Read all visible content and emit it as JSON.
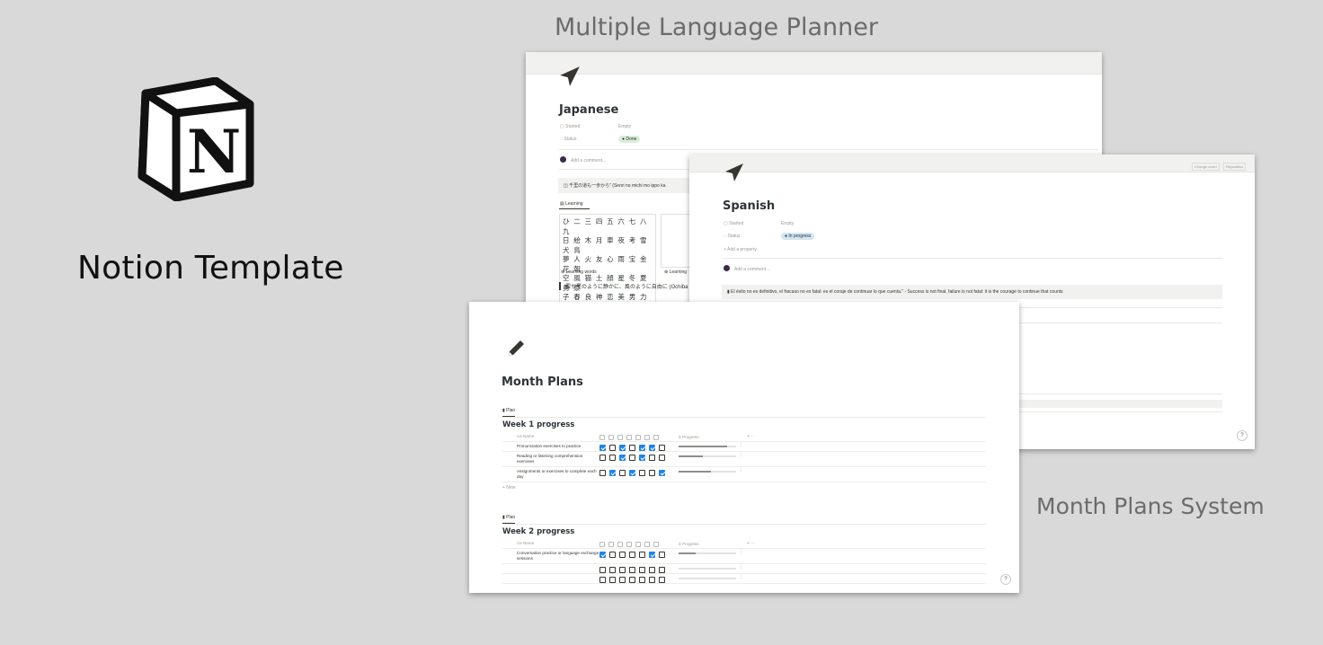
{
  "brand": {
    "title": "Notion Template",
    "logo_letter": "N"
  },
  "captions": {
    "top": "Multiple Language Planner",
    "right": "Month Plans System"
  },
  "japanese": {
    "title": "Japanese",
    "icon": "navigation-arrow-icon",
    "props": [
      {
        "label": "Started",
        "value": "Empty"
      },
      {
        "label": "Status",
        "value": "Done"
      }
    ],
    "comment_placeholder": "Add a comment...",
    "callout": "千里の道も一歩から\" (Senri no michi mo ippo ka",
    "db_tab": "Learning",
    "kanji_lines": [
      "ひ 二 三 四 五 六 七 八 九",
      "日 絵 木 月 車 夜 考 雪 犬 鳥",
      "夢 人 火 友 心 雨 宝 金 花 朝",
      "空 風 猫 土 顔 星 冬 夏 勇 祭",
      "子 春 良 神 恋 美 男 力 愛 賢 幸 母"
    ],
    "learning_words": "Learning words",
    "learning_words_2": "Learning",
    "quote": "雲ち星のように静かに、風のように自由に (Ochiba"
  },
  "spanish": {
    "title": "Spanish",
    "icon": "navigation-arrow-icon",
    "top_buttons": [
      "Change cover",
      "Reposition"
    ],
    "props": [
      {
        "label": "Started",
        "value": "Empty"
      },
      {
        "label": "Status",
        "value": "In progress"
      }
    ],
    "add_property": "Add a property",
    "comment_placeholder": "Add a comment...",
    "callout": "El éxito no es definitivo, el fracaso no es fatal: es el coraje de continuar lo que cuenta.\" - Success is not final, failure is not fatal: it is the courage to continue that counts",
    "help": "?"
  },
  "month_plans": {
    "title": "Month Plans",
    "icon": "pencil-icon",
    "help": "?",
    "weeks": [
      {
        "tab": "Plan",
        "heading": "Week 1 progress",
        "name_header": "Aa Name",
        "progress_header": "Σ Progress",
        "add_new": "+ New",
        "rows": [
          {
            "name": "Pronunciation exercises to practice",
            "checks": [
              true,
              false,
              true,
              false,
              true,
              true,
              false
            ],
            "progress": 0.85
          },
          {
            "name": "Reading or listening comprehension exercises",
            "checks": [
              false,
              false,
              true,
              false,
              true,
              false,
              false
            ],
            "progress": 0.42
          },
          {
            "name": "Assignments or exercises to complete each day",
            "checks": [
              false,
              true,
              false,
              true,
              false,
              false,
              true
            ],
            "progress": 0.57
          }
        ]
      },
      {
        "tab": "Plan",
        "heading": "Week 2 progress",
        "name_header": "Aa Name",
        "progress_header": "Σ Progress",
        "rows": [
          {
            "name": "Conversation practice or language exchange sessions",
            "checks": [
              true,
              false,
              false,
              false,
              false,
              true,
              false
            ],
            "progress": 0.3
          },
          {
            "name": "",
            "checks": [
              false,
              false,
              false,
              false,
              false,
              false,
              false
            ],
            "progress": 0
          },
          {
            "name": "",
            "checks": [
              false,
              false,
              false,
              false,
              false,
              false,
              false
            ],
            "progress": 0
          }
        ]
      }
    ]
  },
  "colors": {
    "background": "#d9d9d9",
    "checkbox_on": "#2383e2",
    "done_pill": "#dbeddb",
    "progress_pill": "#d3e5ef"
  }
}
